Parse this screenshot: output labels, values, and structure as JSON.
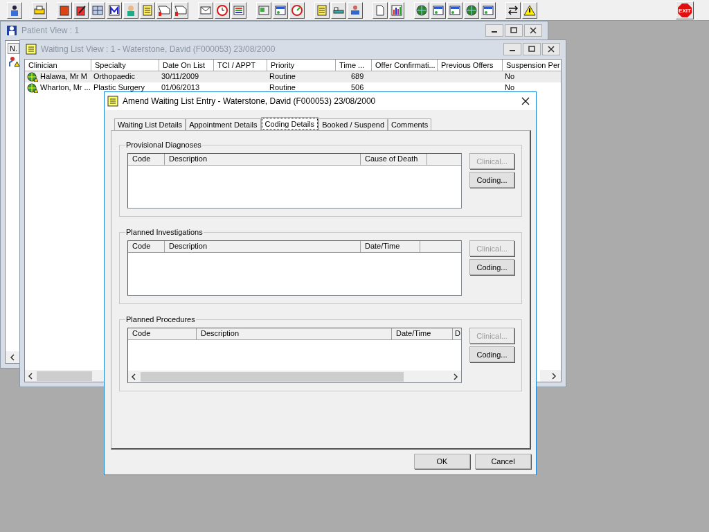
{
  "toolbar": {
    "exit_label": "EXIT"
  },
  "patient_view": {
    "title": "Patient View : 1",
    "column_1": "N."
  },
  "waiting_list_view": {
    "title": "Waiting List View :  1 - Waterstone, David (F000053) 23/08/2000",
    "columns": [
      "Clinician",
      "Specialty",
      "Date On List",
      "TCI / APPT",
      "Priority",
      "Time ...",
      "Offer Confirmati...",
      "Previous Offers",
      "Suspension Per"
    ],
    "rows": [
      {
        "clinician": "Halawa, Mr M",
        "specialty": "Orthopaedic",
        "date_on_list": "30/11/2009",
        "priority": "Routine",
        "time": "689",
        "suspension": "No",
        "selected": true
      },
      {
        "clinician": "Wharton, Mr ...",
        "specialty": "Plastic Surgery",
        "date_on_list": "01/06/2013",
        "priority": "Routine",
        "time": "506",
        "suspension": "No",
        "selected": false
      }
    ]
  },
  "dialog": {
    "title": "Amend Waiting List Entry - Waterstone, David (F000053) 23/08/2000",
    "tabs": [
      {
        "label": "Waiting List Details",
        "selected": false
      },
      {
        "label": "Appointment Details",
        "selected": false
      },
      {
        "label": "Coding Details",
        "selected": true
      },
      {
        "label": "Booked / Suspend",
        "selected": false
      },
      {
        "label": "Comments",
        "selected": false
      }
    ],
    "groups": [
      {
        "title": "Provisional Diagnoses",
        "columns": [
          "Code",
          "Description",
          "Cause of Death"
        ],
        "scrollbar": false,
        "buttons": [
          {
            "label": "Clinical...",
            "disabled": true
          },
          {
            "label": "Coding...",
            "disabled": false
          }
        ]
      },
      {
        "title": "Planned Investigations",
        "columns": [
          "Code",
          "Description",
          "Date/Time"
        ],
        "scrollbar": false,
        "buttons": [
          {
            "label": "Clinical...",
            "disabled": true
          },
          {
            "label": "Coding...",
            "disabled": false
          }
        ]
      },
      {
        "title": "Planned Procedures",
        "columns": [
          "Code",
          "Description",
          "Date/Time",
          "D"
        ],
        "scrollbar": true,
        "buttons": [
          {
            "label": "Clinical...",
            "disabled": true
          },
          {
            "label": "Coding...",
            "disabled": false
          }
        ]
      }
    ],
    "footer_buttons": [
      "OK",
      "Cancel"
    ]
  }
}
